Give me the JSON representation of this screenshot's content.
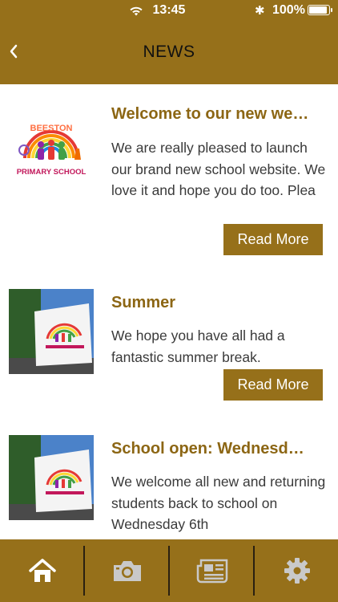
{
  "status_bar": {
    "time": "13:45",
    "battery": "100%"
  },
  "header": {
    "title": "NEWS"
  },
  "news": [
    {
      "title": "Welcome to our new we…",
      "excerpt": "We are really pleased to launch our brand new school website.  We love it and hope you do too.  Plea",
      "read_more": "Read More",
      "thumbnail": "beeston-primary-logo",
      "logo_text": {
        "top": "BEESTON",
        "bottom": "PRIMARY SCHOOL"
      }
    },
    {
      "title": "Summer",
      "excerpt": "We hope you have all had a fantastic summer break.",
      "read_more": "Read More",
      "thumbnail": "school-sign-photo"
    },
    {
      "title": "School open: Wednesd…",
      "excerpt": "We welcome all new and returning students back to school on Wednesday 6th",
      "thumbnail": "school-sign-photo"
    }
  ],
  "tabbar": {
    "items": [
      {
        "icon": "home-icon"
      },
      {
        "icon": "camera-icon"
      },
      {
        "icon": "newspaper-icon"
      },
      {
        "icon": "gear-icon"
      }
    ]
  },
  "colors": {
    "brand": "#96701a",
    "title_text": "#8c6614"
  }
}
